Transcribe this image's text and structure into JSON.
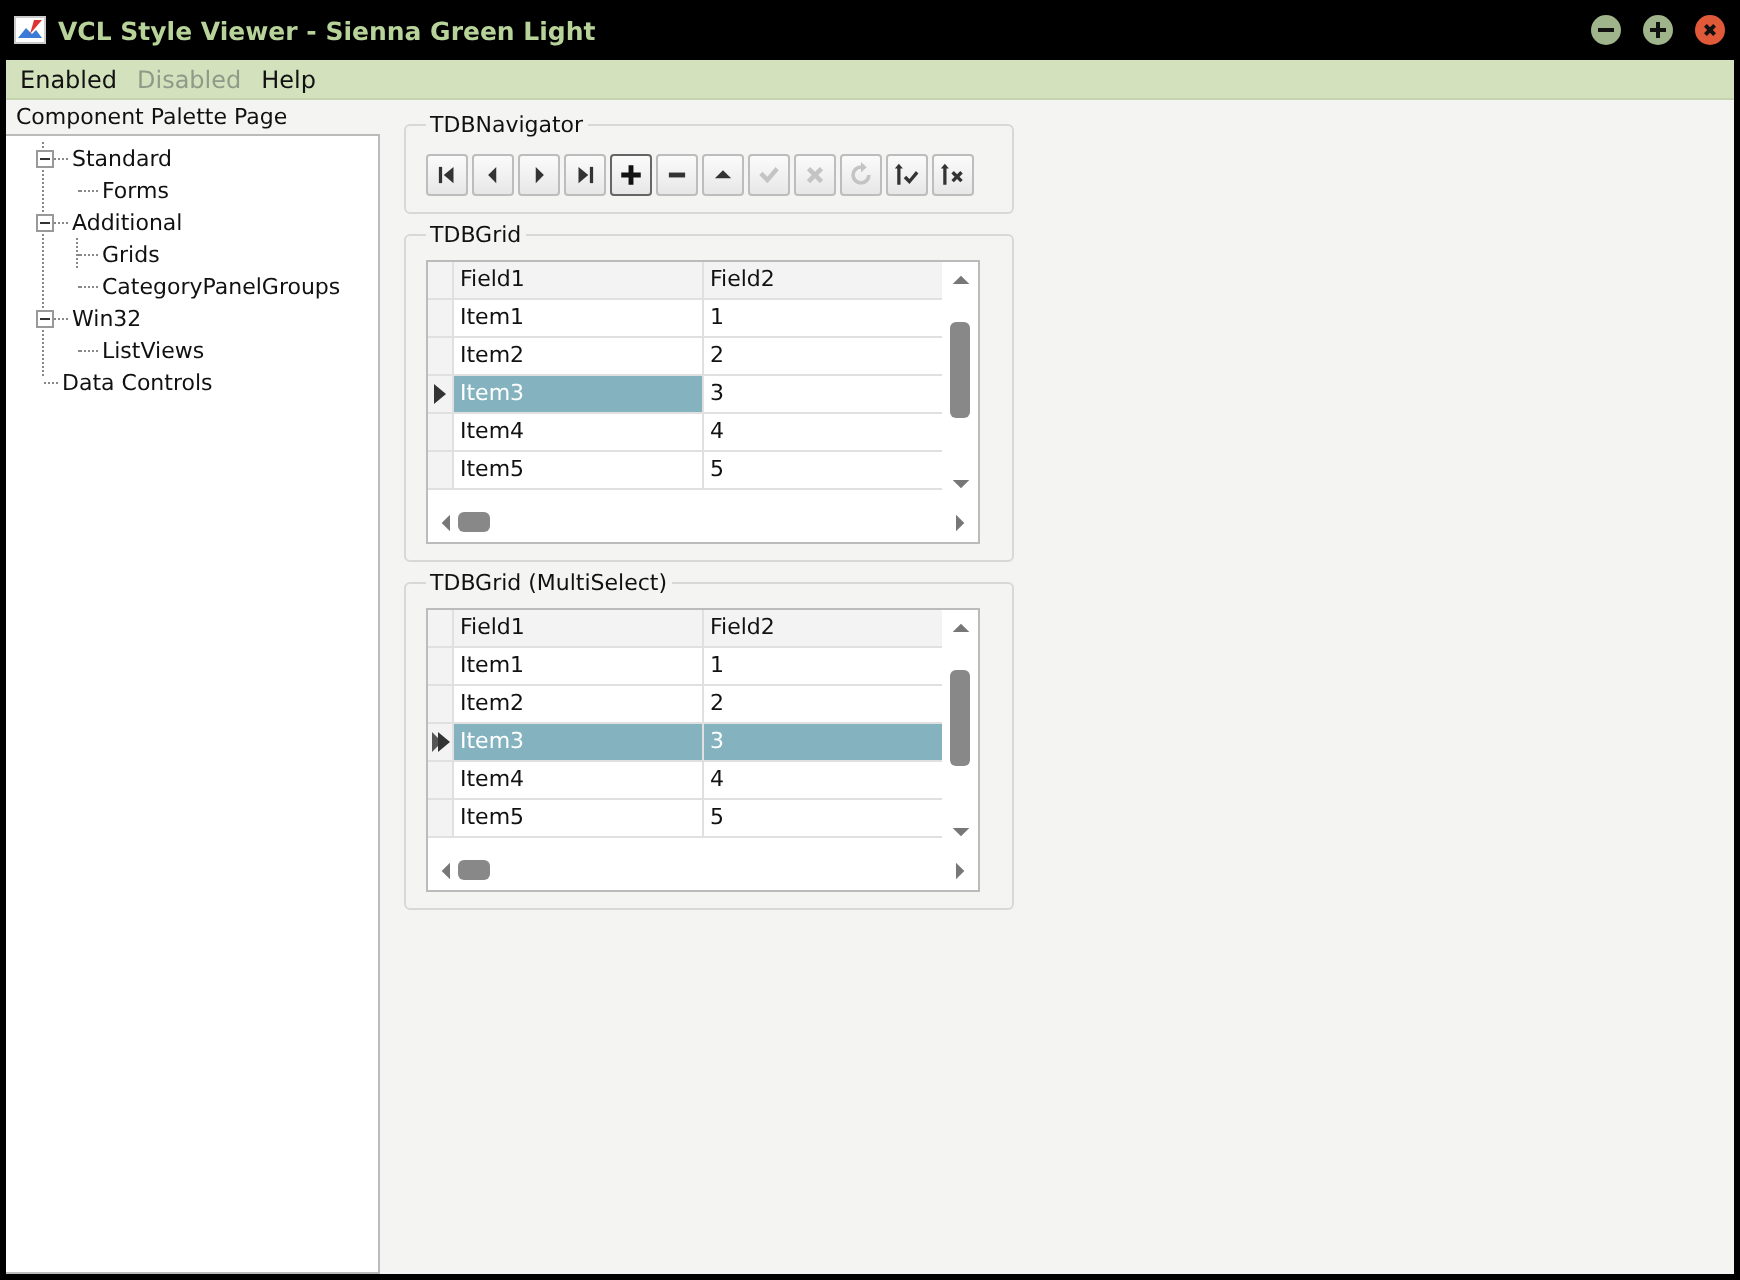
{
  "window": {
    "title": "VCL Style Viewer - Sienna Green Light"
  },
  "menu": [
    {
      "label": "Enabled",
      "disabled": false
    },
    {
      "label": "Disabled",
      "disabled": true
    },
    {
      "label": "Help",
      "disabled": false
    }
  ],
  "sidebar": {
    "title": "Component Palette Page",
    "tree": [
      {
        "label": "Standard",
        "expanded": true,
        "children": [
          {
            "label": "Forms"
          }
        ]
      },
      {
        "label": "Additional",
        "expanded": true,
        "children": [
          {
            "label": "Grids"
          },
          {
            "label": "CategoryPanelGroups"
          }
        ]
      },
      {
        "label": "Win32",
        "expanded": true,
        "children": [
          {
            "label": "ListViews"
          }
        ]
      },
      {
        "label": "Data Controls"
      }
    ]
  },
  "navigator": {
    "title": "TDBNavigator",
    "buttons": [
      {
        "kind": "first",
        "disabled": false,
        "focused": false
      },
      {
        "kind": "prior",
        "disabled": false,
        "focused": false
      },
      {
        "kind": "next",
        "disabled": false,
        "focused": false
      },
      {
        "kind": "last",
        "disabled": false,
        "focused": false
      },
      {
        "kind": "insert",
        "disabled": false,
        "focused": true
      },
      {
        "kind": "delete",
        "disabled": false,
        "focused": false
      },
      {
        "kind": "edit",
        "disabled": false,
        "focused": false
      },
      {
        "kind": "post",
        "disabled": true,
        "focused": false
      },
      {
        "kind": "cancel",
        "disabled": true,
        "focused": false
      },
      {
        "kind": "refresh",
        "disabled": true,
        "focused": false
      },
      {
        "kind": "apply",
        "disabled": false,
        "focused": false
      },
      {
        "kind": "cancel-updates",
        "disabled": false,
        "focused": false
      }
    ]
  },
  "grids": [
    {
      "title": "TDBGrid",
      "multi_select": false,
      "columns": [
        "Field1",
        "Field2"
      ],
      "rows": [
        {
          "current": false,
          "cells": [
            {
              "text": "Item1",
              "selected": false
            },
            {
              "text": "1",
              "selected": false
            }
          ]
        },
        {
          "current": false,
          "cells": [
            {
              "text": "Item2",
              "selected": false
            },
            {
              "text": "2",
              "selected": false
            }
          ]
        },
        {
          "current": true,
          "cells": [
            {
              "text": "Item3",
              "selected": true
            },
            {
              "text": "3",
              "selected": false
            }
          ]
        },
        {
          "current": false,
          "cells": [
            {
              "text": "Item4",
              "selected": false
            },
            {
              "text": "4",
              "selected": false
            }
          ]
        },
        {
          "current": false,
          "cells": [
            {
              "text": "Item5",
              "selected": false
            },
            {
              "text": "5",
              "selected": false
            }
          ]
        }
      ]
    },
    {
      "title": "TDBGrid (MultiSelect)",
      "multi_select": true,
      "columns": [
        "Field1",
        "Field2"
      ],
      "rows": [
        {
          "current": false,
          "cells": [
            {
              "text": "Item1",
              "selected": false
            },
            {
              "text": "1",
              "selected": false
            }
          ]
        },
        {
          "current": false,
          "cells": [
            {
              "text": "Item2",
              "selected": false
            },
            {
              "text": "2",
              "selected": false
            }
          ]
        },
        {
          "current": true,
          "cells": [
            {
              "text": "Item3",
              "selected": true
            },
            {
              "text": "3",
              "selected": true
            }
          ]
        },
        {
          "current": false,
          "cells": [
            {
              "text": "Item4",
              "selected": false
            },
            {
              "text": "4",
              "selected": false
            }
          ]
        },
        {
          "current": false,
          "cells": [
            {
              "text": "Item5",
              "selected": false
            },
            {
              "text": "5",
              "selected": false
            }
          ]
        }
      ]
    }
  ]
}
